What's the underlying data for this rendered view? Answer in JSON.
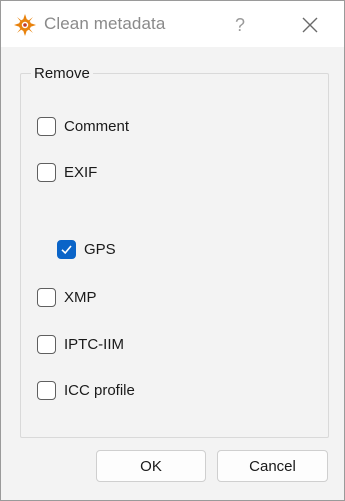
{
  "window": {
    "title": "Clean metadata",
    "help_label": "?"
  },
  "group": {
    "label": "Remove"
  },
  "options": [
    {
      "label": "Comment",
      "checked": false
    },
    {
      "label": "EXIF",
      "checked": false
    },
    {
      "label": "GPS",
      "checked": true
    },
    {
      "label": "XMP",
      "checked": false
    },
    {
      "label": "IPTC-IIM",
      "checked": false
    },
    {
      "label": "ICC profile",
      "checked": false
    }
  ],
  "buttons": {
    "ok_label": "OK",
    "cancel_label": "Cancel"
  },
  "colors": {
    "accent": "#0a64c8",
    "app_icon": "#e8820c"
  },
  "icons": {
    "app": "xnview-app-icon",
    "close": "close-icon",
    "check": "checkmark-icon"
  }
}
